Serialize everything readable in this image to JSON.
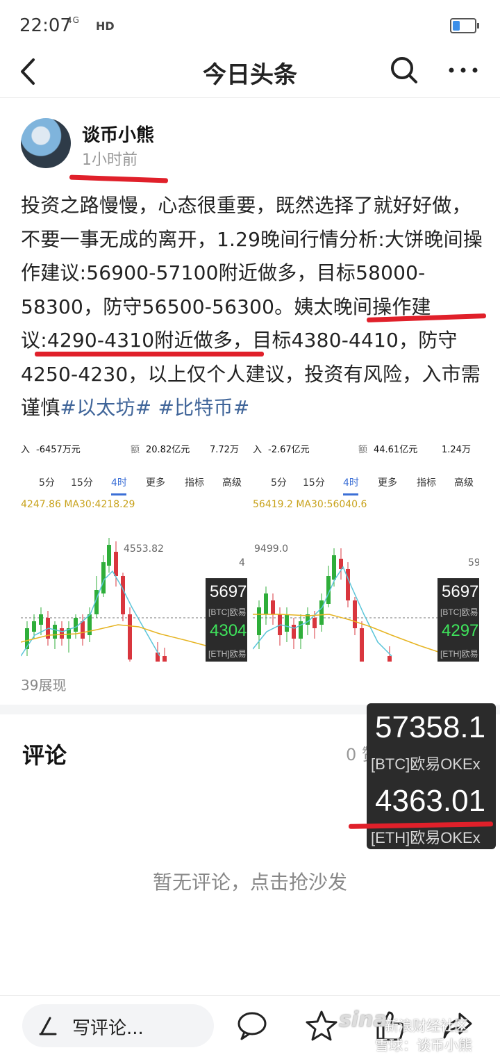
{
  "status_bar": {
    "time": "22:07",
    "network": "4G",
    "hd": "HD"
  },
  "nav": {
    "title": "今日头条"
  },
  "author": {
    "name": "谈币小熊",
    "time": "1小时前"
  },
  "article": {
    "text": "投资之路慢慢，心态很重要，既然选择了就好好做，不要一事无成的离开，1.29晚间行情分析:大饼晚间操作建议:56900-57100附近做多，目标58000-58300，防守56500-56300。姨太晚间操作建议:4290-4310附近做多，目标4380-4410，防守4250-4230，以上仅个人建议，投资有风险，入市需谨慎",
    "tags": [
      "#以太坊#",
      "#比特币#"
    ]
  },
  "charts": [
    {
      "header": {
        "a": "入",
        "b": "-6457万元",
        "c": "额",
        "d": "20.82亿元",
        "e": "7.72万"
      },
      "tabs": [
        "5分",
        "15分",
        "4时",
        "更多",
        "指标",
        "高级"
      ],
      "active_tab": "4时",
      "ma_text": "4247.86  MA30:4218.29",
      "price_label": "4553.82",
      "side_label": "4",
      "overlay": {
        "p1": "5697",
        "l1": "[BTC]欧易",
        "p2": "4304",
        "l2": "[ETH]欧易"
      }
    },
    {
      "header": {
        "a": "入",
        "b": "-2.67亿元",
        "c": "额",
        "d": "44.61亿元",
        "e": "1.24万"
      },
      "tabs": [
        "5分",
        "15分",
        "4时",
        "更多",
        "指标",
        "高级"
      ],
      "active_tab": "4时",
      "ma_text": "56419.2  MA30:56040.6",
      "price_label": "9499.0",
      "side_label": "59",
      "overlay": {
        "p1": "5697",
        "l1": "[BTC]欧易",
        "p2": "4297",
        "l2": "[ETH]欧易"
      }
    }
  ],
  "views": "39展现",
  "comments": {
    "title": "评论",
    "stats": "0 赞 · 0 转发",
    "empty": "暂无评论，点击抢沙发"
  },
  "ticker": {
    "btc_price": "57358.1",
    "btc_label": "[BTC]欧易OKEx",
    "eth_price": "4363.01",
    "eth_label": "[ETH]欧易OKEx"
  },
  "bottom": {
    "input_placeholder": "写评论..."
  },
  "watermark": {
    "logo": "sina",
    "line1": "新浪财经社区",
    "line2": "雪球：谈币小熊"
  },
  "colors": {
    "red_mark": "#e0202a",
    "tag_blue": "#406599",
    "active_tab": "#3b6fd6",
    "candle_up": "#2fae3a",
    "candle_down": "#d9363e",
    "ma_line": "#e6b422"
  }
}
